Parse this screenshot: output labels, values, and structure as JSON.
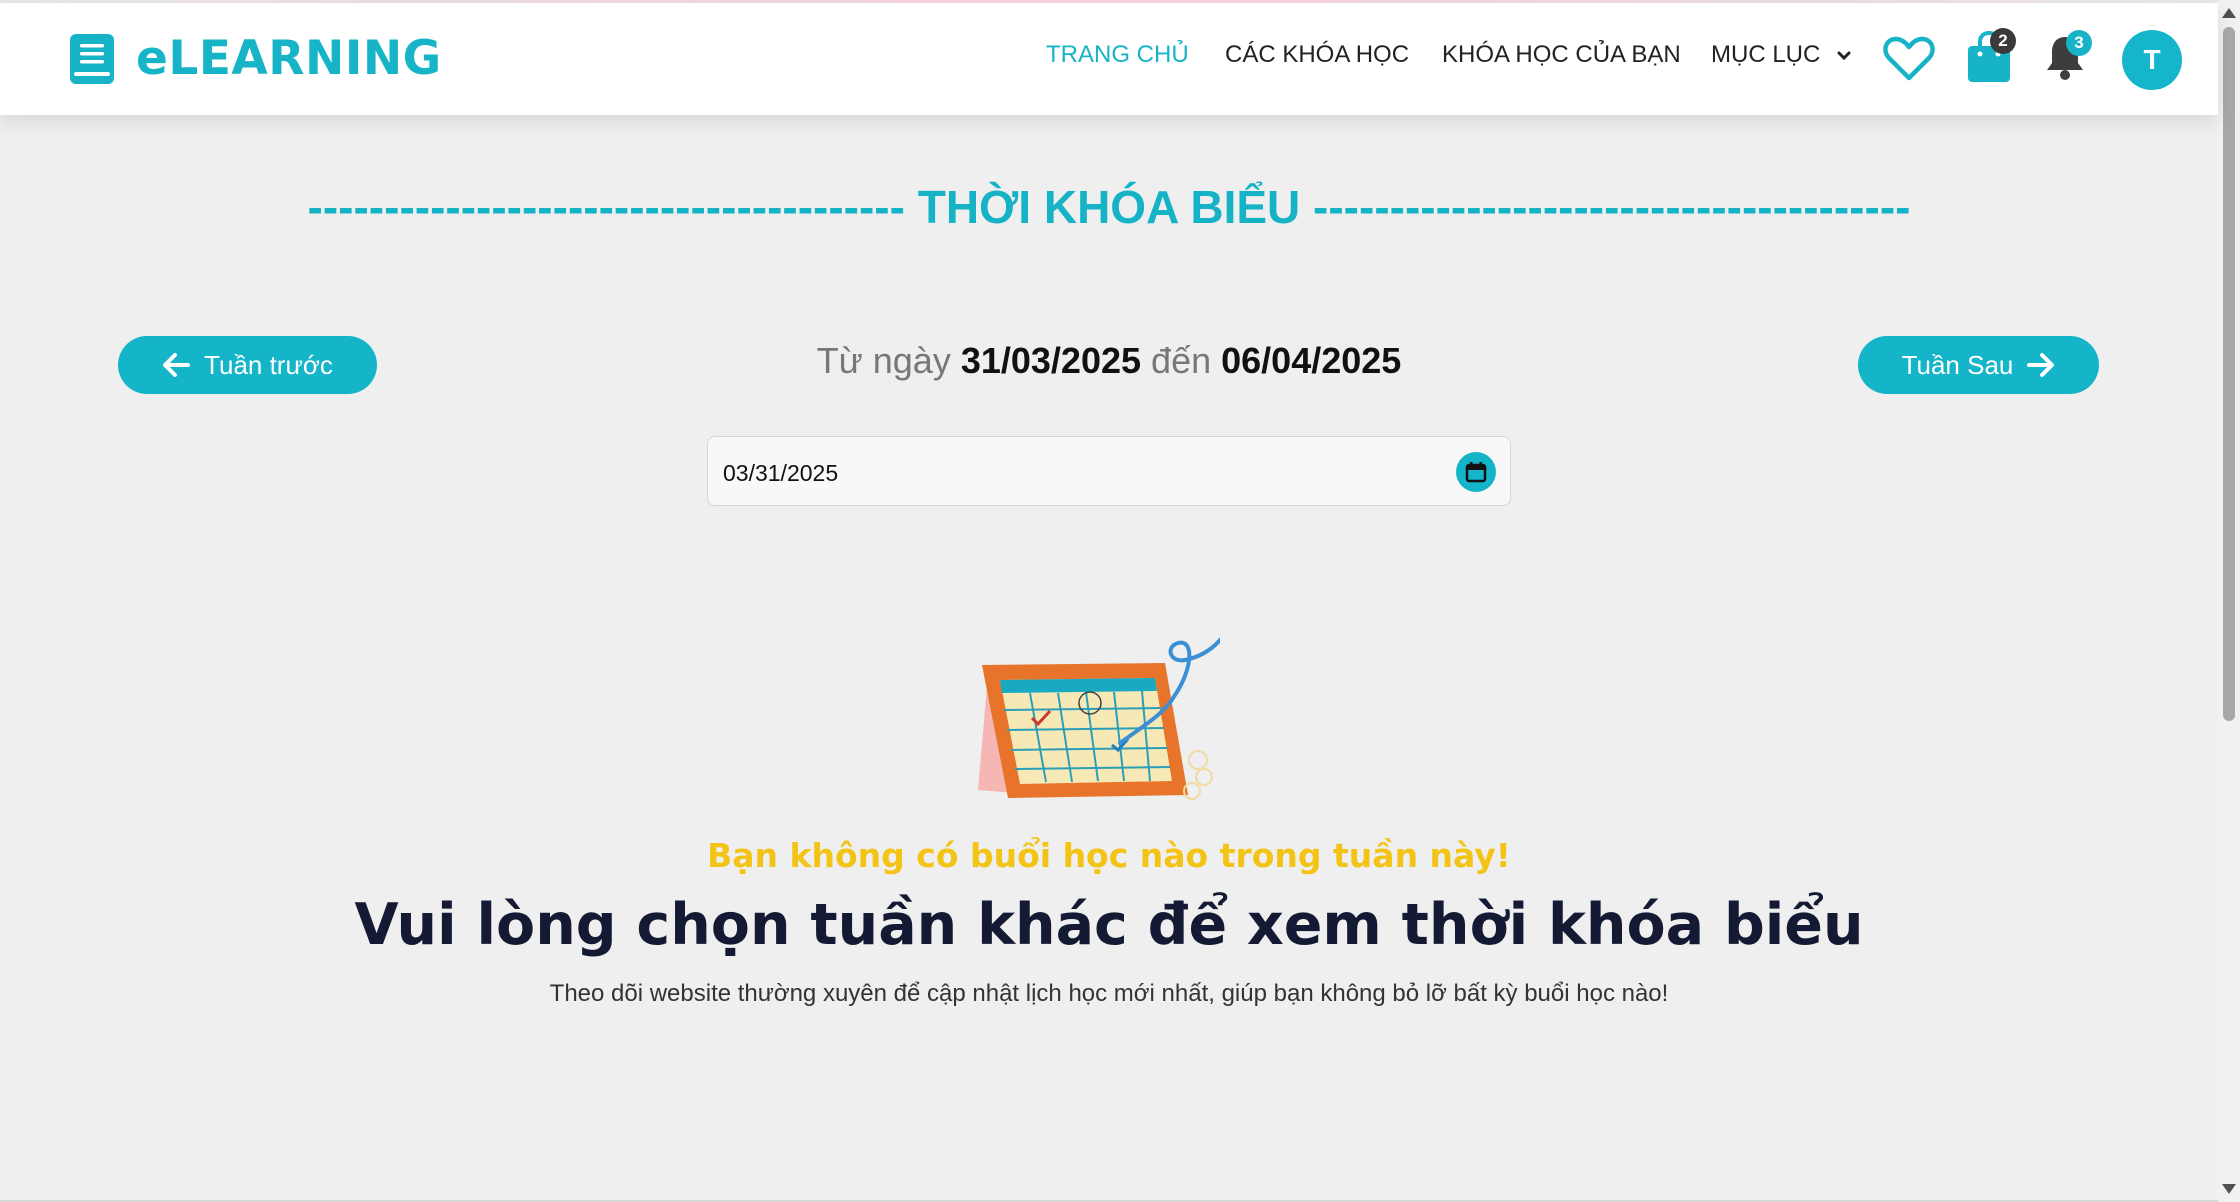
{
  "brand": {
    "name": "eLEARNING",
    "color": "#17b4c8"
  },
  "nav": {
    "home": "TRANG CHỦ",
    "courses": "CÁC KHÓA HỌC",
    "my_courses": "KHÓA HỌC CỦA BẠN",
    "catalog": "MỤC LỤC"
  },
  "header_icons": {
    "wishlist": "heart-icon",
    "cart": "shopping-bag-icon",
    "cart_count": "2",
    "notifications": "bell-icon",
    "notification_count": "3",
    "avatar_initial": "T"
  },
  "page": {
    "title": "--------------------------------------- THỜI KHÓA BIỂU ---------------------------------------",
    "prev_week": "Tuần trước",
    "next_week": "Tuần Sau",
    "range_from_label": "Từ ngày",
    "range_from": "31/03/2025",
    "range_to_label": "đến",
    "range_to": "06/04/2025",
    "date_input_value": "03/31/2025",
    "empty_title": "Bạn không có buổi học nào trong tuần này!",
    "empty_heading": "Vui lòng chọn tuần khác để xem thời khóa biểu",
    "empty_note": "Theo dõi website thường xuyên để cập nhật lịch học mới nhất, giúp bạn không bỏ lỡ bất kỳ buổi học nào!"
  },
  "colors": {
    "accent": "#14b4c9",
    "warning": "#f3c316",
    "heading": "#141a33"
  }
}
